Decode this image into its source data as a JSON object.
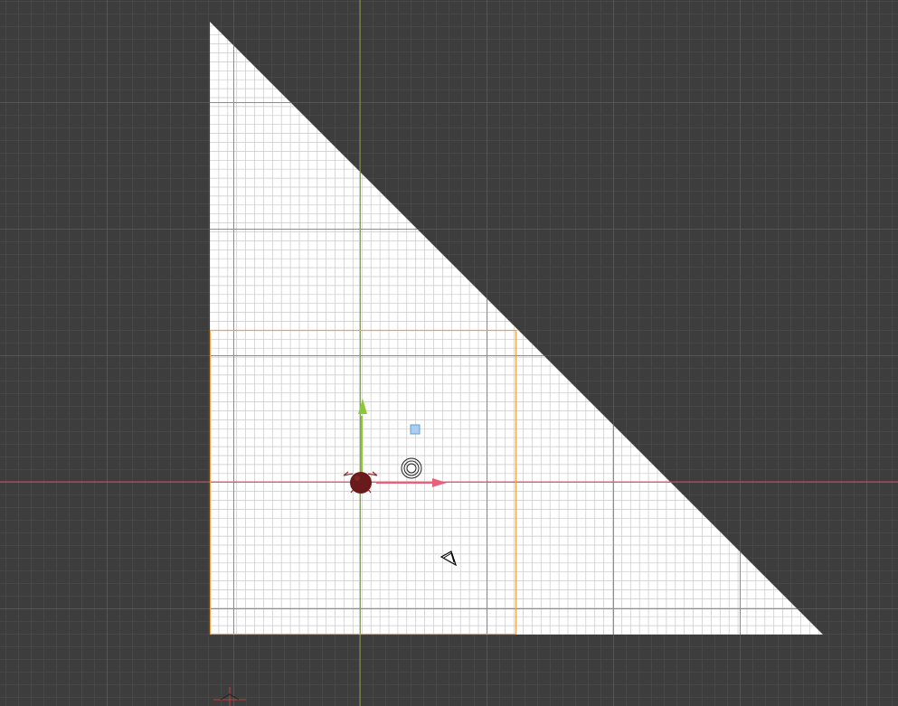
{
  "viewport": {
    "mode": "top-orthographic",
    "background_color": "#3d3d3d",
    "grid_color": "#4a4a4a",
    "x_axis_color": "#d9536a",
    "y_axis_color": "#8aa83a"
  },
  "scene": {
    "plane": {
      "shape": "right-triangle",
      "fill_color": "#ffffff",
      "grid_line_color": "#c8c8c8",
      "grid_major_line_color": "#8c8c8c"
    },
    "selection": {
      "outline_color": "#f0a040"
    },
    "objects": [
      {
        "name": "selected-object",
        "icon": "dark-red-sphere-icon",
        "color": "#6a1a1a"
      },
      {
        "name": "light-empty",
        "icon": "light-ring-icon"
      },
      {
        "name": "lamp",
        "icon": "small-square-light-icon",
        "color": "#a8cff2"
      },
      {
        "name": "camera",
        "icon": "camera-cone-icon"
      },
      {
        "name": "world-origin",
        "icon": "origin-marker-icon",
        "color": "#c04040"
      }
    ],
    "gizmo": {
      "x_arrow_color": "#e8607a",
      "y_arrow_color": "#8ac83a"
    }
  }
}
